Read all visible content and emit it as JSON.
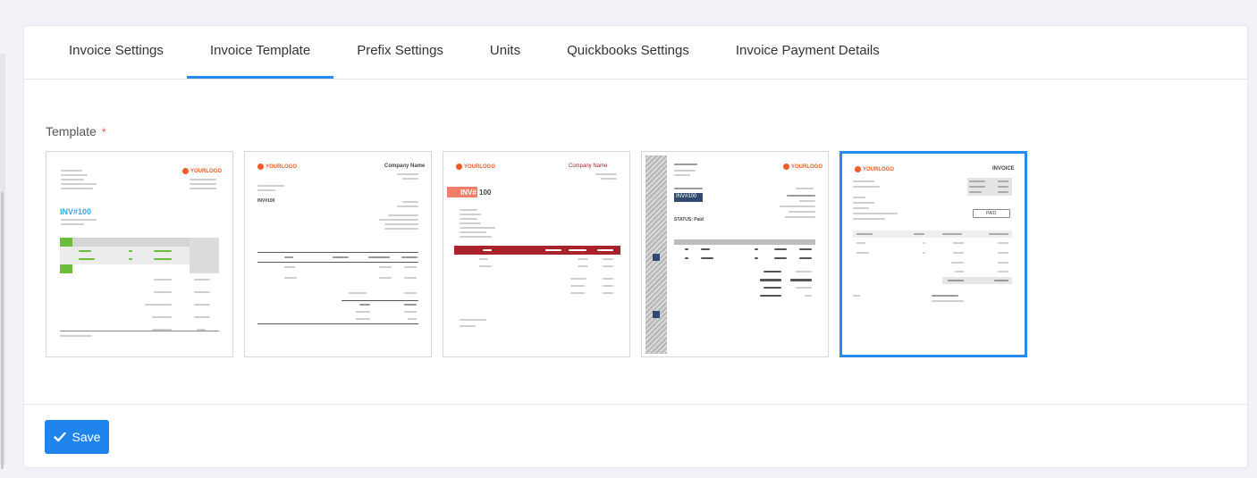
{
  "tabs": [
    {
      "label": "Invoice Settings",
      "active": false
    },
    {
      "label": "Invoice Template",
      "active": true
    },
    {
      "label": "Prefix Settings",
      "active": false
    },
    {
      "label": "Units",
      "active": false
    },
    {
      "label": "Quickbooks Settings",
      "active": false
    },
    {
      "label": "Invoice Payment Details",
      "active": false
    }
  ],
  "template_field": {
    "label": "Template",
    "required_mark": "*"
  },
  "templates": [
    {
      "id": "template-1",
      "selected": false,
      "invoice_no": "INV#100",
      "accent": "#3aa9e0",
      "row_accent": "#6bbd3c"
    },
    {
      "id": "template-2",
      "selected": false,
      "invoice_no": "INV#100",
      "company": "Company Name"
    },
    {
      "id": "template-3",
      "selected": false,
      "invoice_no": "100",
      "tag": "INV#",
      "company": "Company Name",
      "accent": "#a8232b"
    },
    {
      "id": "template-4",
      "selected": false,
      "invoice_no": "INV#100",
      "status": "STATUS: Paid"
    },
    {
      "id": "template-5",
      "selected": true,
      "title": "INVOICE",
      "paid": "PAID"
    }
  ],
  "logo_text": "YOURLOGO",
  "save_button": {
    "label": "Save"
  },
  "colors": {
    "accent": "#2a8bef",
    "button": "#1f85ec",
    "required": "#e74c3c"
  }
}
